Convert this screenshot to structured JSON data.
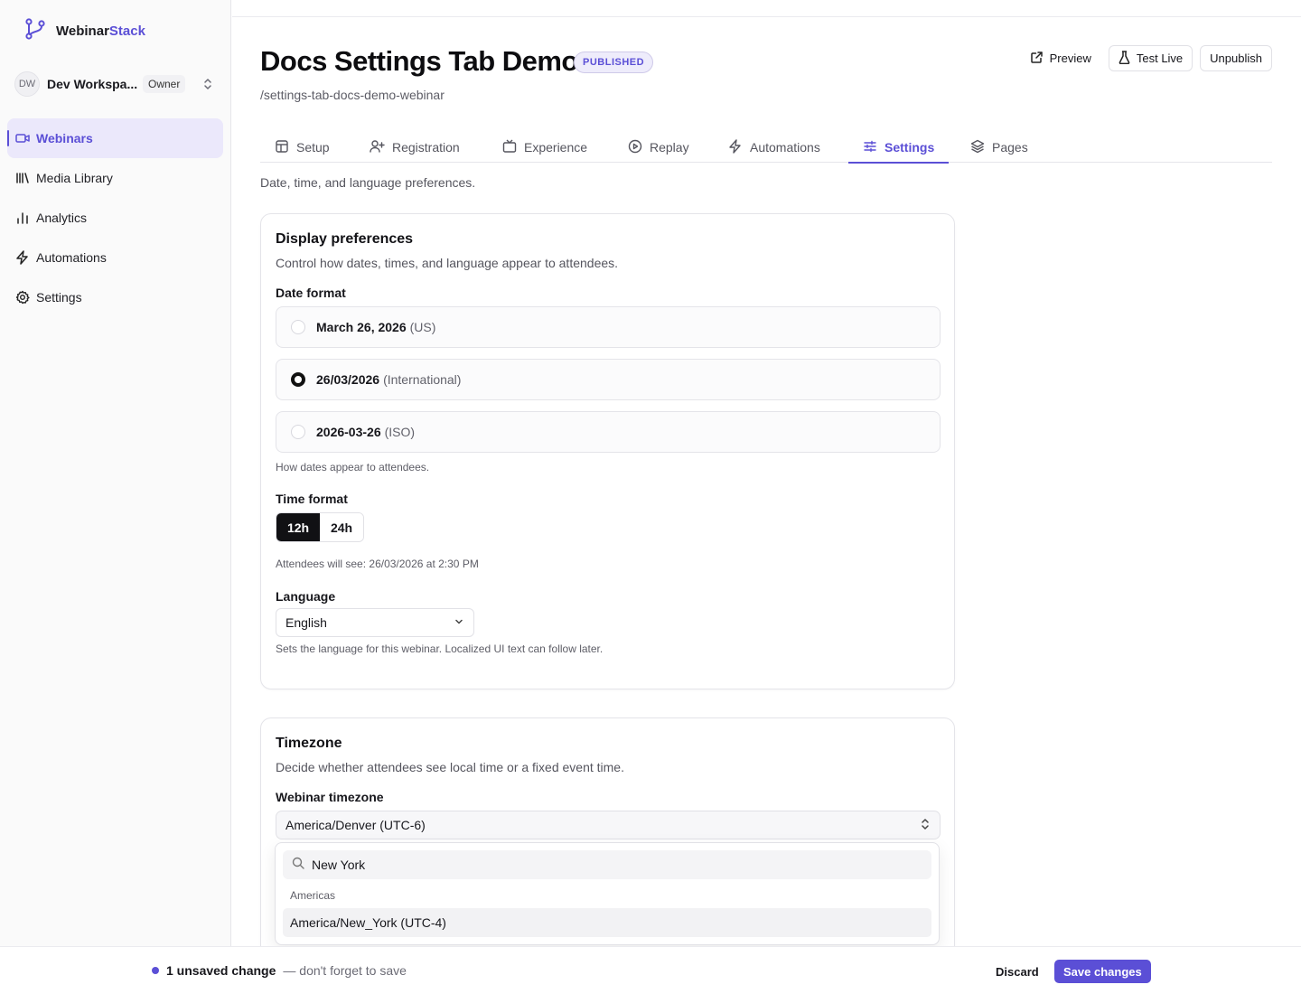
{
  "brand": {
    "name_part1": "Webinar",
    "name_part2": "Stack",
    "accent_color": "#5b4fd6",
    "logo_icon": "branch-icon"
  },
  "workspace": {
    "initials": "DW",
    "name": "Dev Workspa...",
    "role": "Owner"
  },
  "sidebar": {
    "items": [
      {
        "label": "Webinars",
        "icon": "video-icon",
        "active": true
      },
      {
        "label": "Media Library",
        "icon": "library-icon",
        "active": false
      },
      {
        "label": "Analytics",
        "icon": "bar-chart-icon",
        "active": false
      },
      {
        "label": "Automations",
        "icon": "lightning-icon",
        "active": false
      },
      {
        "label": "Settings",
        "icon": "gear-icon",
        "active": false
      }
    ]
  },
  "header": {
    "title": "Docs Settings Tab Demo",
    "status_badge": "PUBLISHED",
    "slug": "/settings-tab-docs-demo-webinar",
    "actions": {
      "preview": "Preview",
      "test_live": "Test Live",
      "unpublish": "Unpublish"
    }
  },
  "tabs": [
    {
      "label": "Setup",
      "icon": "layout-icon"
    },
    {
      "label": "Registration",
      "icon": "user-plus-icon"
    },
    {
      "label": "Experience",
      "icon": "tv-icon"
    },
    {
      "label": "Replay",
      "icon": "play-circle-icon"
    },
    {
      "label": "Automations",
      "icon": "lightning-icon"
    },
    {
      "label": "Settings",
      "icon": "sliders-icon",
      "active": true
    },
    {
      "label": "Pages",
      "icon": "layers-icon"
    }
  ],
  "tab_description": "Date, time, and language preferences.",
  "display_preferences": {
    "title": "Display preferences",
    "subtitle": "Control how dates, times, and language appear to attendees.",
    "date_format": {
      "label": "Date format",
      "options": [
        {
          "value": "March 26, 2026",
          "note": "(US)",
          "checked": false
        },
        {
          "value": "26/03/2026",
          "note": "(International)",
          "checked": true
        },
        {
          "value": "2026-03-26",
          "note": "(ISO)",
          "checked": false
        }
      ],
      "hint": "How dates appear to attendees."
    },
    "time_format": {
      "label": "Time format",
      "options": [
        "12h",
        "24h"
      ],
      "selected": "12h",
      "preview": "Attendees will see: 26/03/2026 at 2:30 PM"
    },
    "language": {
      "label": "Language",
      "selected": "English",
      "hint": "Sets the language for this webinar. Localized UI text can follow later."
    }
  },
  "timezone": {
    "title": "Timezone",
    "subtitle": "Decide whether attendees see local time or a fixed event time.",
    "label": "Webinar timezone",
    "selected": "America/Denver (UTC-6)",
    "dropdown": {
      "search_value": "New York",
      "group": "Americas",
      "options": [
        "America/New_York (UTC-4)"
      ]
    }
  },
  "unsaved_bar": {
    "count_text": "1 unsaved change",
    "note": "— don't forget to save",
    "discard": "Discard",
    "save": "Save changes"
  }
}
